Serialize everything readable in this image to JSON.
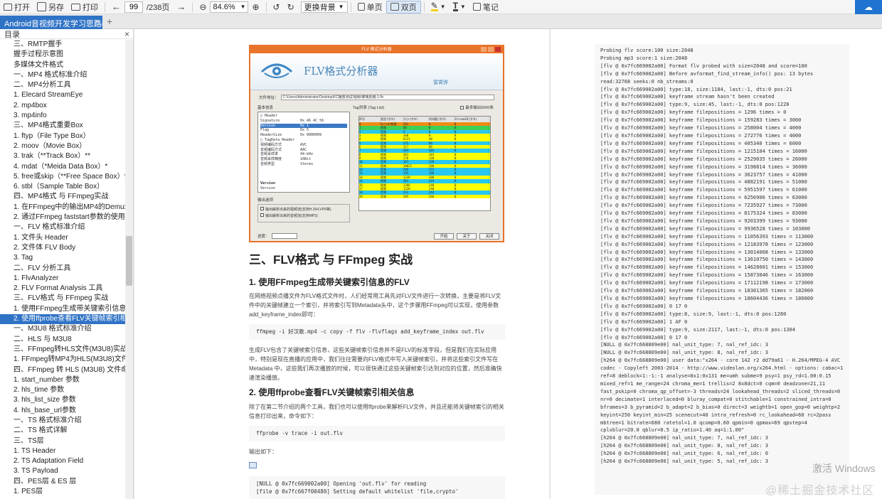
{
  "toolbar": {
    "open": "打开",
    "save_as": "另存",
    "print": "打印",
    "current_page": "99",
    "total_pages": "/238页",
    "zoom": "84.6%",
    "background": "更换背景",
    "single_page": "单页",
    "double_page": "双页",
    "notes": "笔记"
  },
  "tab": {
    "title": "Android音视频开发学习思路("
  },
  "sidebar": {
    "title": "目录",
    "items": [
      "三、RMTP握手",
      "握手过程示意图",
      "多媒体文件格式",
      "一、MP4 格式标准介绍",
      "二、MP4分析工具",
      "1. Elecard StreamEye",
      "2. mp4box",
      "3. mp4info",
      "三、MP4格式重要Box",
      "1. ftyp（File Type Box）",
      "2. moov（Movie Box）",
      "3. trak（**Track Box）**",
      "4. mdat（*Meida Data Box）*",
      "5. free或skip（**Free Space Box）**",
      "6. stbl（Sample Table Box）",
      "四、MP4格式 与 FFmpeg实战",
      "1. 在FFmpeg中的输出MP4的Demuxer信",
      "2. 通过FFmpeg faststart参数的使用，来",
      "一、FLV 格式标准介绍",
      "1. 文件头 Header",
      "2. 文件体 FLV Body",
      "3. Tag",
      "二、FLV 分析工具",
      "1. FlvAnalyzer",
      "2. FLV Format Analysis 工具",
      "三、FLV格式 与 FFmpeg 实战",
      "1. 使用FFmpeg生成带关键索引信息的FL",
      "2. 使用ffprobe查看FLV关键帧索引相关信",
      "一、M3U8 格式标准介绍",
      "二、HLS 与 M3U8",
      "三、FFmpeg转HLS文件(M3U8)实战",
      "1. FFmpeg转MP4为HLS(M3U8)文件",
      "四、FFmpeg 转 HLS (M3U8) 文件命令参",
      "1. start_number 参数",
      "2. hls_time 参数",
      "3. hls_list_size 参数",
      "4. hls_base_url参数",
      "一、TS 格式标准介绍",
      "二、TS 格式详解",
      "三、TS层",
      "1. TS Header",
      "2. TS Adaptation Field",
      "3. TS Payload",
      "四、PES层 & ES 层",
      "1. PES层"
    ]
  },
  "analyzer": {
    "window_title": "FLV 格式分析器",
    "brand": "FLV格式分析器",
    "author": "雷霄骅",
    "file_label": "文件地址：",
    "file_path": "C:\\Users\\Administrator\\Desktop\\FC播放测试\\视频\\玻璃走路-1.flv",
    "basic_info": "基本信息",
    "tag_list": "Tag列表 (Tag List)",
    "max_check": "最多输出5000条",
    "output_options": "输出选项",
    "opt1": "输出解析出来的视频流(支持H.264,VP6等)",
    "opt2": "输出解析出来的音频流(支持MP3)",
    "progress": "进度：",
    "btn_start": "开始",
    "btn_about": "关于",
    "btn_close": "关闭",
    "tree": [
      {
        "k": "□ Header",
        "v": ""
      },
      {
        "k": "  Signature",
        "v": "0x 46 4C 56"
      },
      {
        "k": "  Version",
        "v": "0x 1"
      },
      {
        "k": "  Flag",
        "v": "0x 5"
      },
      {
        "k": "  HeaderSize",
        "v": "0x 0000009"
      },
      {
        "k": "□ TagData Header",
        "v": ""
      },
      {
        "k": "  视频编码方式",
        "v": "AVC"
      },
      {
        "k": "  音频编码方式",
        "v": "AAC"
      },
      {
        "k": "  音频采样率",
        "v": "44-kHz"
      },
      {
        "k": "  音频采样精度",
        "v": "16Bit"
      },
      {
        "k": "  音频类型",
        "v": "Stereo"
      }
    ],
    "tree_bottom": [
      "Version",
      "Version"
    ],
    "table_header": [
      "序号",
      "类型(字节)",
      "大小(字节)",
      "时间戳(字节)",
      "StreamID(字节)"
    ],
    "rows": [
      [
        "0",
        "Script数据",
        "282",
        "0",
        "0",
        "o"
      ],
      [
        "1",
        "视频",
        "48",
        "0",
        "0",
        "g"
      ],
      [
        "2",
        "音频",
        "4",
        "0",
        "0",
        "c"
      ],
      [
        "3",
        "视频",
        "340",
        "0",
        "0",
        "y"
      ],
      [
        "4",
        "视频",
        "6221",
        "40",
        "0",
        "y"
      ],
      [
        "5",
        "音频",
        "175",
        "80",
        "0",
        "c"
      ],
      [
        "6",
        "视频",
        "317",
        "80",
        "0",
        "y"
      ],
      [
        "7",
        "音频",
        "201",
        "103",
        "0",
        "c"
      ],
      [
        "8",
        "视频",
        "201",
        "103",
        "0",
        "y"
      ],
      [
        "9",
        "视频",
        "176",
        "120",
        "0",
        "y"
      ],
      [
        "10",
        "音频",
        "167",
        "139",
        "0",
        "c"
      ],
      [
        "11",
        "视频",
        "10021",
        "160",
        "0",
        "y"
      ],
      [
        "12",
        "音频",
        "205",
        "172",
        "0",
        "c"
      ],
      [
        "13",
        "音频",
        "195",
        "196",
        "0",
        "c"
      ],
      [
        "14",
        "视频",
        "1338",
        "200",
        "0",
        "y"
      ],
      [
        "15",
        "视频",
        "301",
        "219",
        "0",
        "c"
      ],
      [
        "16",
        "视频",
        "1286",
        "240",
        "0",
        "y"
      ],
      [
        "17",
        "视频",
        "1320",
        "240",
        "0",
        "y"
      ],
      [
        "18",
        "音频",
        "212",
        "242",
        "0",
        "c"
      ],
      [
        "19",
        "音频",
        "205",
        "266",
        "0",
        "y"
      ]
    ]
  },
  "article": {
    "h1": "三、FLV格式 与 FFmpeg 实战",
    "s1_title": "1. 使用FFmpeg生成带关键索引信息的FLV",
    "s1_p1": "在网络视频点播文件为FLV格式文件时，人们经常用工具先对FLV文件进行一次转换，主要是将FLV文件中的关键帧建立一个索引，并将索引写到Metadata头中，这个步骤用FFmpeg可以实现，使用参数 add_keyframe_index即可：",
    "s1_code": "ffmpeg -i 好汉歌.mp4 -c copy -f flv -flvflags add_keyframe_index out.flv",
    "s1_p2": "生成FLV包含了关键帧索引信息，这些关键帧索引信息并不是FLV的标准字段，但是我们在实际应用中，特别是现在直播的应用中，我们往往需要向FLV格式中写入关键帧索引，并将这些索引文件写在 Metadata 中，这些我们再次播放的时候，可以很快通过这些关键帧索引达到对应的位置，然后准确快速渲染播放。",
    "s2_title": "2. 使用ffprobe查看FLV关键帧索引相关信息",
    "s2_p1": "除了在第二节介绍的两个工具，我们也可以使用ffprobe来解析FLV文件，并且还能将关键帧索引的相关信息打印出来，命令如下：",
    "s2_code": "ffprobe -v trace -i out.flv",
    "s2_p2": "输出如下：",
    "out_code": [
      "[NULL @ 0x7fc669002a00] Opening 'out.flv' for reading",
      "[file @ 0x7fc667f00480] Setting default whitelist 'file,crypto'"
    ]
  },
  "log": [
    "Probing flv score:100 size:2048",
    "Probing mp3 score:1 size:2048",
    "[flv @ 0x7fc669002a00] Format flv probed with size=2048 and score=100",
    "[flv @ 0x7fc669002a00] Before avformat_find_stream_info() pos: 13 bytes",
    "read:32768 seeks:0 nb_streams:0",
    "[flv @ 0x7fc669002a00] type:18, size:1184, last:-1, dts:0 pos:21",
    "[flv @ 0x7fc669002a00] keyframe stream hasn't been created",
    "[flv @ 0x7fc669002a00] type:9, size:45, last:-1, dts:0 pos:1220",
    "[flv @ 0x7fc669002a00] keyframe filepositions = 1296 times = 0",
    "[flv @ 0x7fc669002a00] keyframe filepositions = 159283 times = 3000",
    "[flv @ 0x7fc669002a00] keyframe filepositions = 258004 times = 4000",
    "[flv @ 0x7fc669002a00] keyframe filepositions = 272776 times = 4000",
    "[flv @ 0x7fc669002a00] keyframe filepositions = 405340 times = 6000",
    "[flv @ 0x7fc669002a00] keyframe filepositions = 1215104 times = 16000",
    "[flv @ 0x7fc669002a00] keyframe filepositions = 2529035 times = 26000",
    "[flv @ 0x7fc669002a00] keyframe filepositions = 3198814 times = 36000",
    "[flv @ 0x7fc669002a00] keyframe filepositions = 3623757 times = 41000",
    "[flv @ 0x7fc669002a00] keyframe filepositions = 4882191 times = 51000",
    "[flv @ 0x7fc669002a00] keyframe filepositions = 5951597 times = 61000",
    "[flv @ 0x7fc669002a00] keyframe filepositions = 6256906 times = 63000",
    "[flv @ 0x7fc669002a00] keyframe filepositions = 7235927 times = 73000",
    "[flv @ 0x7fc669002a00] keyframe filepositions = 8175324 times = 83000",
    "[flv @ 0x7fc669002a00] keyframe filepositions = 9203399 times = 93000",
    "[flv @ 0x7fc669002a00] keyframe filepositions = 9936528 times = 103000",
    "[flv @ 0x7fc669002a00] keyframe filepositions = 11056393 times = 113000",
    "[flv @ 0x7fc669002a00] keyframe filepositions = 12183978 times = 123000",
    "[flv @ 0x7fc669002a00] keyframe filepositions = 13014068 times = 133000",
    "[flv @ 0x7fc669002a00] keyframe filepositions = 13610750 times = 143000",
    "[flv @ 0x7fc669002a00] keyframe filepositions = 14628601 times = 153000",
    "[flv @ 0x7fc669002a00] keyframe filepositions = 15873046 times = 163000",
    "[flv @ 0x7fc669002a00] keyframe filepositions = 17112198 times = 173000",
    "[flv @ 0x7fc669002a00] keyframe filepositions = 18301365 times = 182000",
    "[flv @ 0x7fc669002a00] keyframe filepositions = 18604436 times = 186000",
    "[flv @ 0x7fc669002a00] 0 17 0",
    "[flv @ 0x7fc669002a00] type:8, size:9, last:-1, dts:0 pos:1280",
    "[flv @ 0x7fc669002a00] 1 AF 0",
    "[flv @ 0x7fc669002a00] type:9, size:2117, last:-1, dts:0 pos:1304",
    "[flv @ 0x7fc669002a00] 0 17 0",
    "[NULL @ 0x7fc668809e00] nal_unit_type: 7, nal_ref_idc: 3",
    "[NULL @ 0x7fc668809e00] nal_unit_type: 8, nal_ref_idc: 3",
    "[h264 @ 0x7fc668809e00] user data:\"x264 - core 142 r2 dd79a61 - H.264/MPEG-4 AVC",
    "codec - Copyleft 2003-2014 - http://www.videolan.org/x264.html - options: cabac=1",
    "ref=8 deblock=1:-1:-1 analyse=0x1:0x131 me=umh subme=9 psy=1 psy_rd=1.00:0.15",
    "mixed_ref=1 me_range=24 chroma_me=1 trellis=2 8x8dct=0 cqm=0 deadzone=21,11",
    "fast_pskip=0 chroma_qp_offset=-3 threads=24 lookahead_threads=2 sliced_threads=0",
    "nr=0 decimate=1 interlaced=0 bluray_compat=0 stitchable=1 constrained_intra=0",
    "bframes=3 b_pyramid=2 b_adapt=2 b_bias=0 direct=3 weightb=1 open_gop=0 weightp=2",
    "keyint=250 keyint_min=25 scenecut=40 intra_refresh=0 rc_lookahead=60 rc=2pass",
    "mbtree=1 bitrate=680 ratetol=1.0 qcomp=0.60 qpmin=0 qpmax=69 qpstep=4",
    "cplxblur=20.0 qblur=0.5 ip_ratio=1.40 aq=1:1.00\"",
    "[h264 @ 0x7fc668809e00] nal_unit_type: 7, nal_ref_idc: 3",
    "[h264 @ 0x7fc668809e00] nal_unit_type: 8, nal_ref_idc: 3",
    "[h264 @ 0x7fc668809e00] nal_unit_type: 6, nal_ref_idc: 0",
    "[h264 @ 0x7fc668809e00] nal_unit_type: 5, nal_ref_idc: 3"
  ],
  "watermarks": {
    "windows": "激活 Windows",
    "site": "@稀土掘金技术社区"
  },
  "colors": {
    "accent": "#2f73c6",
    "analyzer_frame": "#e8732a"
  }
}
